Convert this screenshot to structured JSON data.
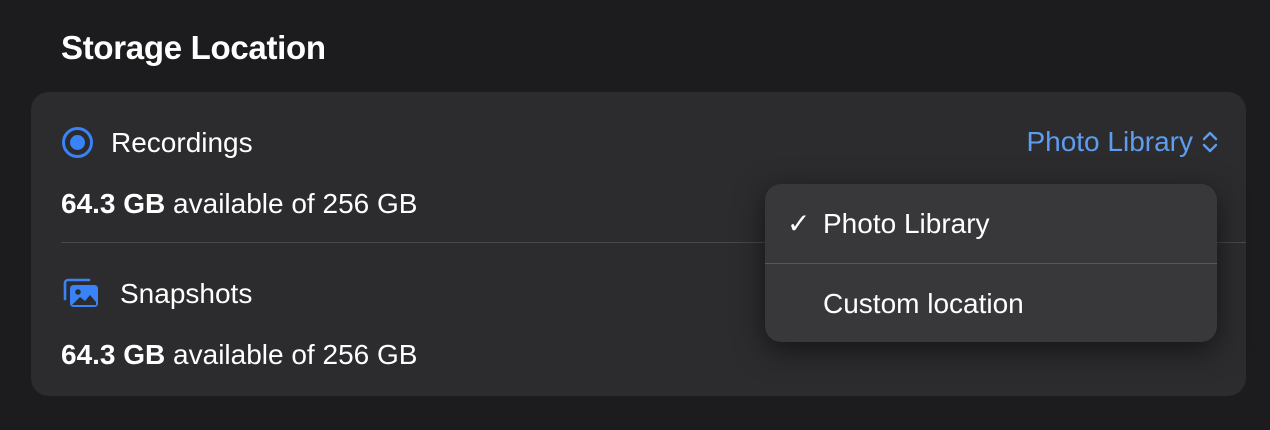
{
  "section": {
    "title": "Storage Location"
  },
  "recordings": {
    "label": "Recordings",
    "icon": "record-icon",
    "available_amount": "64.3 GB",
    "available_text": " available of 256 GB",
    "picker_value": "Photo Library"
  },
  "snapshots": {
    "label": "Snapshots",
    "icon": "photos-icon",
    "available_amount": "64.3 GB",
    "available_text": " available of 256 GB"
  },
  "menu": {
    "items": [
      {
        "label": "Photo Library",
        "checked": true,
        "check_glyph": "✓"
      },
      {
        "label": "Custom location",
        "checked": false
      }
    ]
  },
  "colors": {
    "accent": "#5e9cf0",
    "icon_blue": "#3a82f7",
    "background": "#1c1c1e",
    "card": "#2c2c2e",
    "menu": "#38383a"
  }
}
